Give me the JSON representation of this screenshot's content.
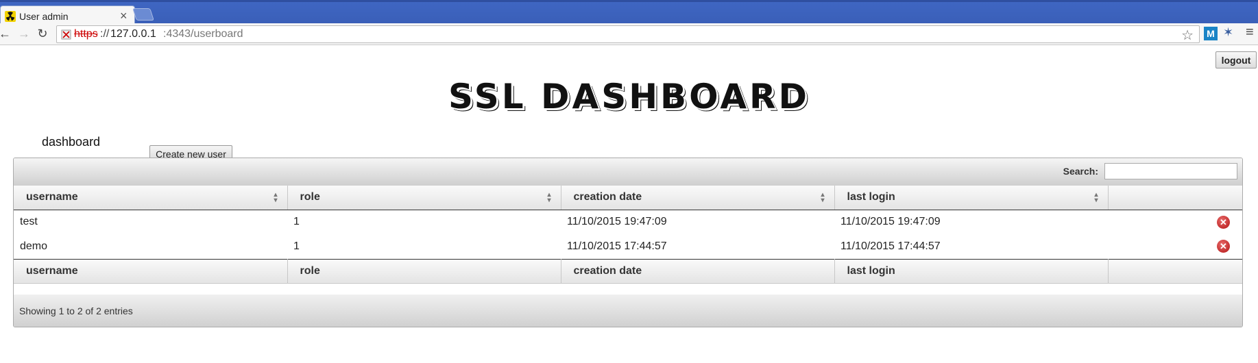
{
  "browser": {
    "tab_title": "User admin",
    "tab_close": "×",
    "url_scheme": "https",
    "url_sep": "://",
    "url_host": "127.0.0.1",
    "url_rest": ":4343/userboard",
    "ext_m_label": "M"
  },
  "page": {
    "logout_label": "logout",
    "title": "SSL DASHBOARD",
    "nav_dashboard": "dashboard",
    "create_user_label": "Create new user"
  },
  "table": {
    "search_label": "Search:",
    "search_value": "",
    "columns": [
      "username",
      "role",
      "creation date",
      "last login"
    ],
    "rows": [
      {
        "username": "test",
        "role": "1",
        "creation_date": "11/10/2015 19:47:09",
        "last_login": "11/10/2015 19:47:09"
      },
      {
        "username": "demo",
        "role": "1",
        "creation_date": "11/10/2015 17:44:57",
        "last_login": "11/10/2015 17:44:57"
      }
    ],
    "info": "Showing 1 to 2 of 2 entries"
  },
  "icons": {
    "back": "back-arrow-icon",
    "forward": "forward-arrow-icon",
    "reload": "reload-icon",
    "star": "bookmark-star-icon",
    "delete": "delete-icon"
  },
  "colors": {
    "tabstrip": "#3f66c2",
    "delete_red": "#b31414"
  }
}
